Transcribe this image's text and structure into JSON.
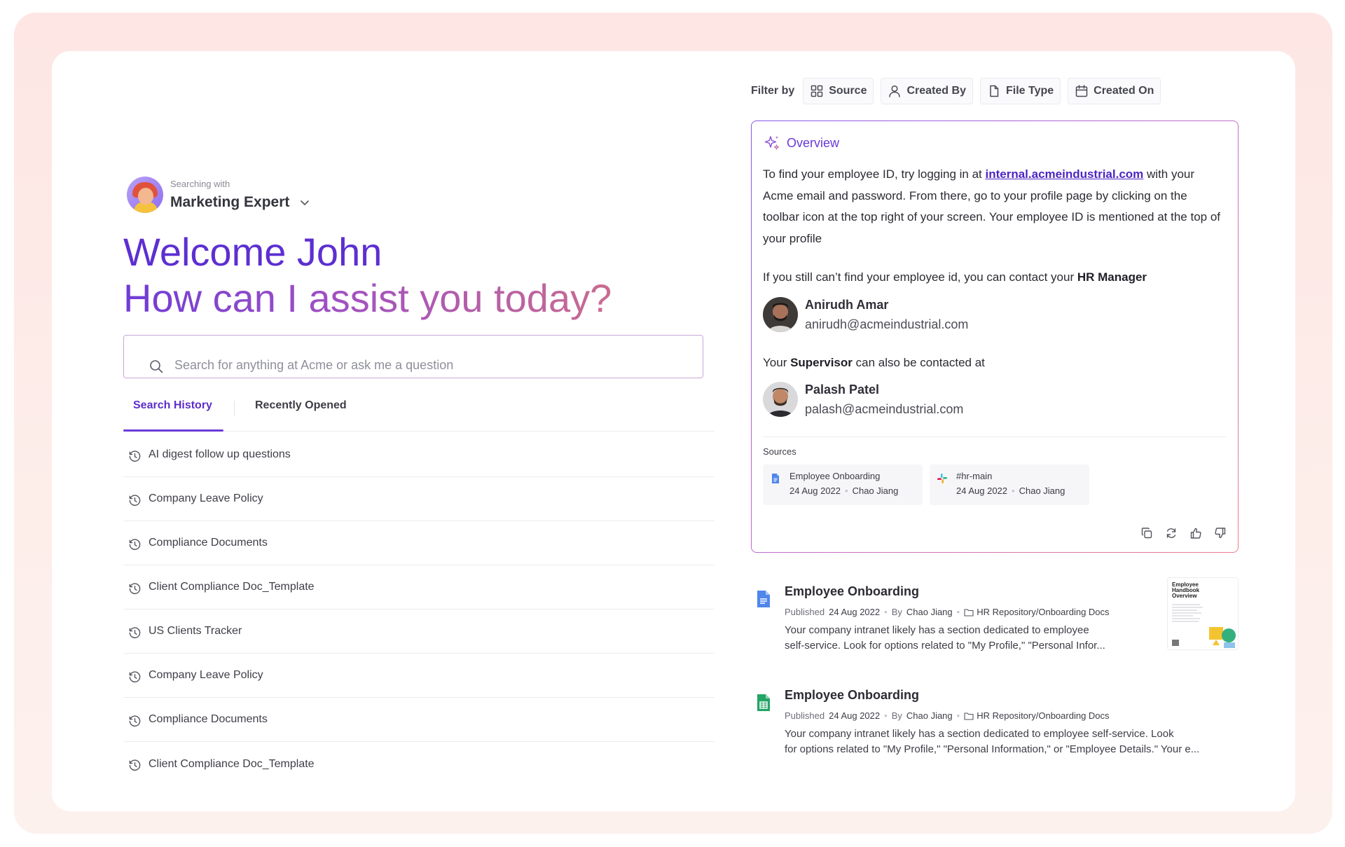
{
  "persona": {
    "caption": "Searching with",
    "name": "Marketing Expert"
  },
  "hero": {
    "welcome": "Welcome John",
    "assist": "How can I assist you today?"
  },
  "search": {
    "placeholder": "Search for anything at Acme or ask me a question",
    "value": ""
  },
  "tabs": {
    "active": "Search History",
    "inactive": "Recently Opened"
  },
  "history": [
    "AI digest follow up questions",
    "Company Leave Policy",
    "Compliance Documents",
    "Client Compliance Doc_Template",
    "US Clients Tracker",
    "Company Leave Policy",
    "Compliance Documents",
    "Client Compliance Doc_Template"
  ],
  "filter": {
    "label": "Filter by",
    "chips": [
      {
        "label": "Source",
        "icon": "grid-icon"
      },
      {
        "label": "Created By",
        "icon": "user-icon"
      },
      {
        "label": "File Type",
        "icon": "file-icon"
      },
      {
        "label": "Created On",
        "icon": "calendar-icon"
      }
    ]
  },
  "overview": {
    "title": "Overview",
    "para_pre": "To find your employee ID, try logging in at ",
    "link": "internal.acmeindustrial.com",
    "para_post": " with your Acme email and password. From there, go to your profile page by clicking on the toolbar icon at the top right of your screen. Your employee ID is mentioned at the top of your profile",
    "hr_line_pre": "If you still can’t find your employee id, you can contact your ",
    "hr_line_bold": "HR Manager",
    "hr_contact": {
      "name": "Anirudh Amar",
      "email": "anirudh@acmeindustrial.com"
    },
    "sup_line_pre": "Your ",
    "sup_line_bold": "Supervisor",
    "sup_line_post": " can also be contacted at",
    "sup_contact": {
      "name": "Palash Patel",
      "email": "palash@acmeindustrial.com"
    },
    "sources_label": "Sources",
    "sources": [
      {
        "title": "Employee Onboarding",
        "date": "24 Aug 2022",
        "author": "Chao Jiang",
        "icon": "google-docs-icon"
      },
      {
        "title": "#hr-main",
        "date": "24 Aug 2022",
        "author": "Chao Jiang",
        "icon": "slack-icon"
      }
    ],
    "actions": [
      "copy-icon",
      "refresh-icon",
      "thumbs-up-icon",
      "thumbs-down-icon"
    ]
  },
  "results": [
    {
      "title": "Employee Onboarding",
      "published_label": "Published",
      "date": "24 Aug 2022",
      "by_label": "By",
      "author": "Chao Jiang",
      "path": "HR Repository/Onboarding Docs",
      "snippet_1": "Your company intranet likely has a section dedicated to employee",
      "snippet_2": "self-service. Look for options related to \"My Profile,\" \"Personal Infor...",
      "icon": "google-docs-icon",
      "thumb_title": "Employee Handbook Overview"
    },
    {
      "title": "Employee Onboarding",
      "published_label": "Published",
      "date": "24 Aug 2022",
      "by_label": "By",
      "author": "Chao Jiang",
      "path": "HR Repository/Onboarding Docs",
      "snippet_1": "Your company intranet likely has a section dedicated to employee self-service. Look",
      "snippet_2": "for options related to \"My Profile,\" \"Personal Information,\" or \"Employee Details.\" Your e...",
      "icon": "google-sheets-icon"
    }
  ],
  "colors": {
    "accent": "#5d2fd1",
    "link": "#4c25c4",
    "frame_bg": "#fde6e4"
  }
}
